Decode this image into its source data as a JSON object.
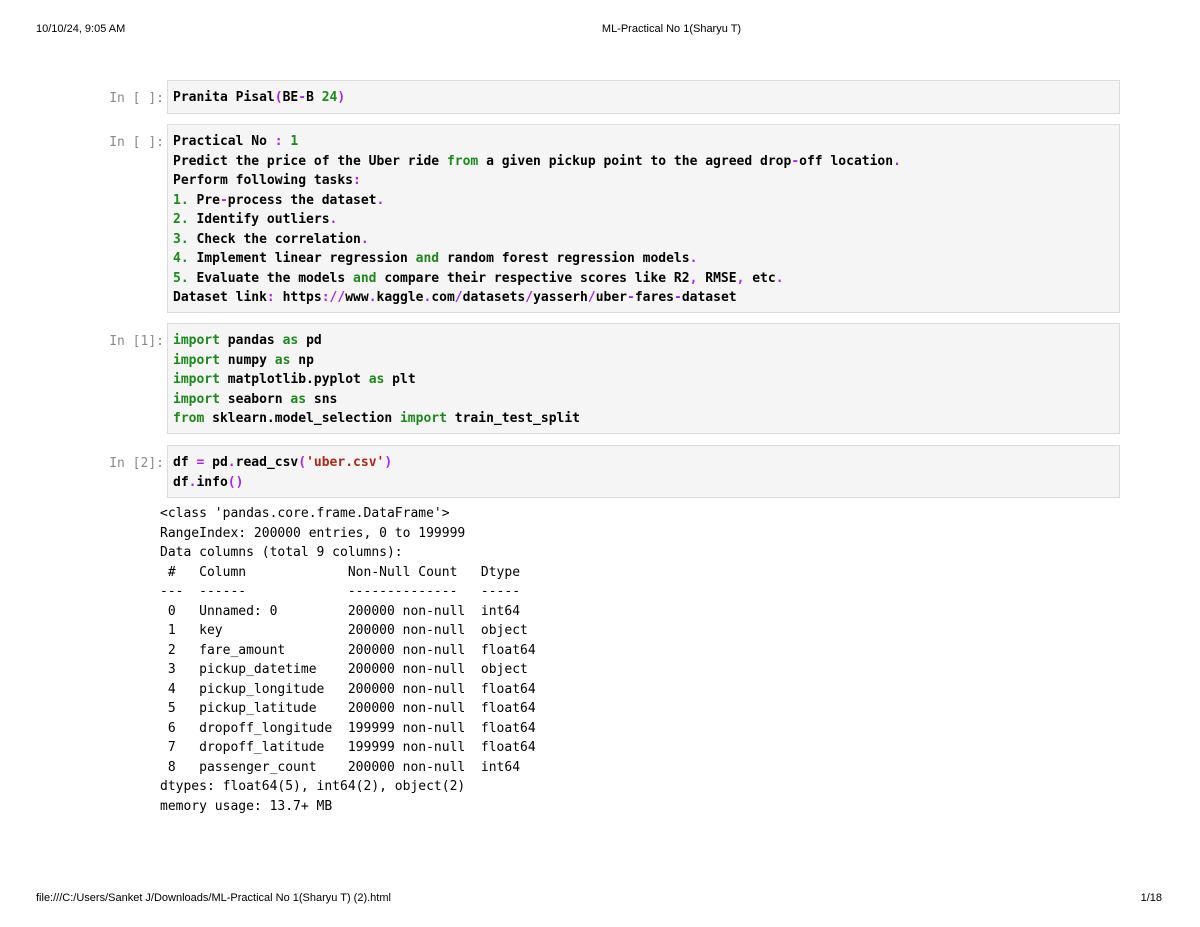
{
  "header": {
    "timestamp": "10/10/24, 9:05 AM",
    "title": "ML-Practical No 1(Sharyu T)"
  },
  "footer": {
    "file_path": "file:///C:/Users/Sanket J/Downloads/ML-Practical No 1(Sharyu T) (2).html",
    "page": "1/18"
  },
  "cells": [
    {
      "prompt": "In [ ]:",
      "lines": [
        "Pranita Pisal(BE-B 24)"
      ]
    },
    {
      "prompt": "In [ ]:",
      "lines": [
        "Practical No : 1",
        "Predict the price of the Uber ride from a given pickup point to the agreed drop-off location.",
        "Perform following tasks:",
        "1. Pre-process the dataset.",
        "2. Identify outliers.",
        "3. Check the correlation.",
        "4. Implement linear regression and random forest regression models.",
        "5. Evaluate the models and compare their respective scores like R2, RMSE, etc.",
        "Dataset link: https://www.kaggle.com/datasets/yasserh/uber-fares-dataset"
      ]
    },
    {
      "prompt": "In [1]:",
      "lines": [
        "import pandas as pd",
        "import numpy as np",
        "import matplotlib.pyplot as plt",
        "import seaborn as sns",
        "from sklearn.model_selection import train_test_split"
      ]
    },
    {
      "prompt": "In [2]:",
      "lines": [
        "df = pd.read_csv('uber.csv')",
        "df.info()"
      ]
    }
  ],
  "output_lines": [
    "<class 'pandas.core.frame.DataFrame'>",
    "RangeIndex: 200000 entries, 0 to 199999",
    "Data columns (total 9 columns):",
    " #   Column             Non-Null Count   Dtype",
    "---  ------             --------------   -----",
    " 0   Unnamed: 0         200000 non-null  int64",
    " 1   key                200000 non-null  object",
    " 2   fare_amount        200000 non-null  float64",
    " 3   pickup_datetime    200000 non-null  object",
    " 4   pickup_longitude   200000 non-null  float64",
    " 5   pickup_latitude    200000 non-null  float64",
    " 6   dropoff_longitude  199999 non-null  float64",
    " 7   dropoff_latitude   199999 non-null  float64",
    " 8   passenger_count    200000 non-null  int64",
    "dtypes: float64(5), int64(2), object(2)",
    "memory usage: 13.7+ MB"
  ]
}
